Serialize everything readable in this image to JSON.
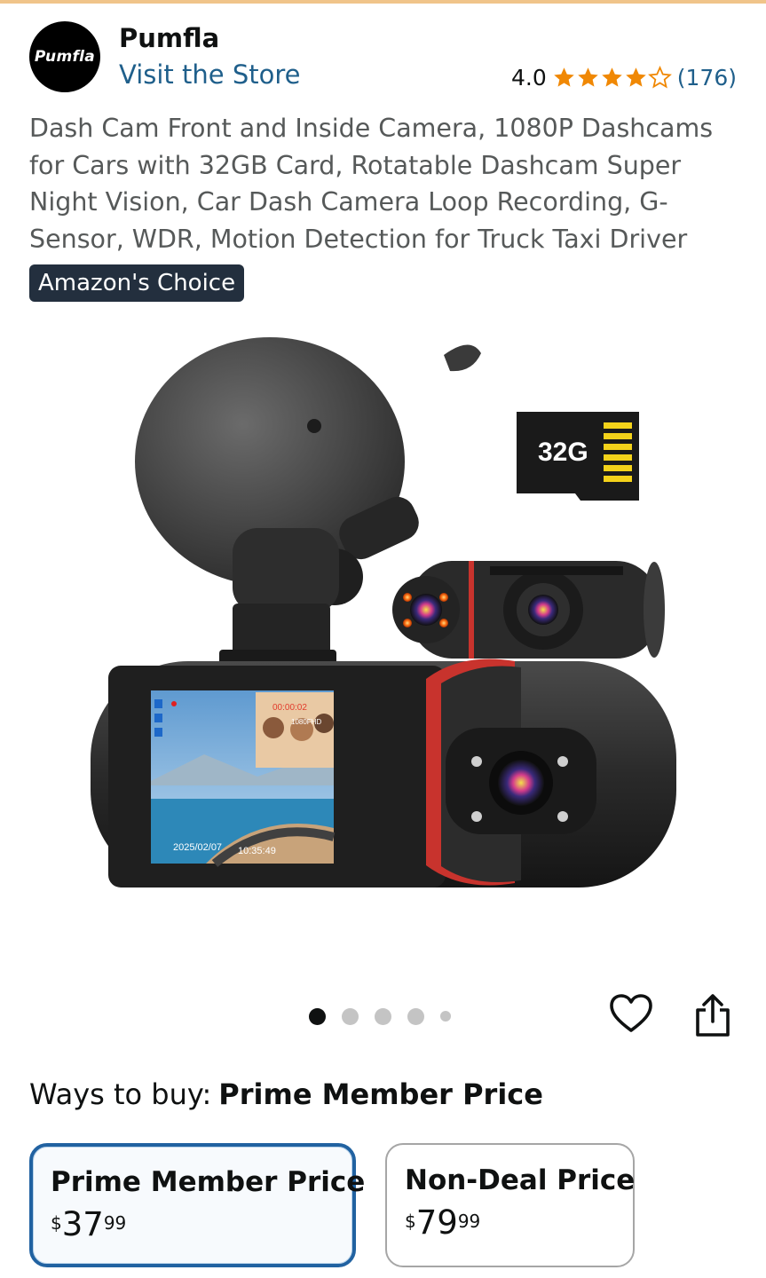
{
  "brand": {
    "logo_text": "Pumfla",
    "name": "Pumfla",
    "visit_store": "Visit the Store"
  },
  "rating": {
    "value": "4.0",
    "stars": 4,
    "max_stars": 5,
    "count": "(176)",
    "star_color": "#f08804"
  },
  "product": {
    "title": "Dash Cam Front and Inside Camera, 1080P Dashcams for Cars with 32GB Card, Rotatable Dashcam Super Night Vision, Car Dash Camera Loop Recording, G-Sensor, WDR, Motion Detection for Truck Taxi Driver",
    "badge": "Amazon's Choice",
    "image": {
      "sd_card_label": "32G",
      "screen_date": "2025/02/07",
      "screen_time": "10:35:49",
      "screen_resolution": "1080FHD",
      "screen_rec": "00:00:02"
    }
  },
  "gallery": {
    "image_count": 5,
    "active_index": 0
  },
  "actions": {
    "wishlist_icon": "heart-icon",
    "share_icon": "share-icon"
  },
  "buying": {
    "ways_label": "Ways to buy:",
    "ways_value": "Prime Member Price",
    "options": [
      {
        "label": "Prime Member Price",
        "currency": "$",
        "whole": "37",
        "fraction": "99",
        "selected": true
      },
      {
        "label": "Non-Deal Price",
        "currency": "$",
        "whole": "79",
        "fraction": "99",
        "selected": false
      }
    ]
  },
  "colors": {
    "link": "#1f5f8b",
    "badge_bg": "#232f3e",
    "selected_border": "#2162a1"
  }
}
